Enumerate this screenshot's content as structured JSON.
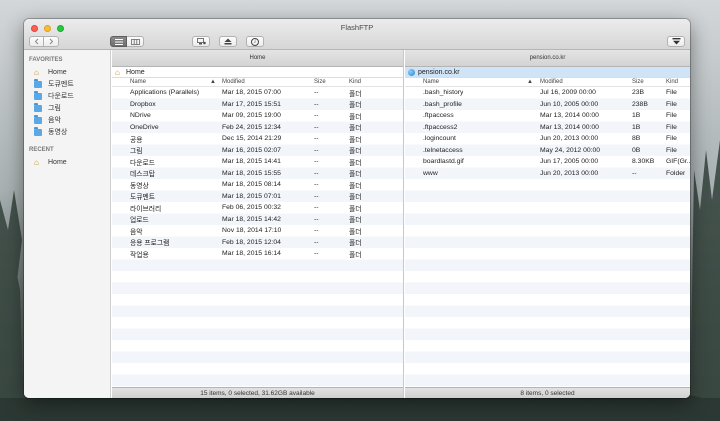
{
  "window": {
    "title": "FlashFTP"
  },
  "toolbar": {
    "back_icon": "chevron-left-icon",
    "forward_icon": "chevron-right-icon",
    "view_list_icon": "list-view-icon",
    "view_columns_icon": "column-view-icon",
    "connect_icon": "connect-icon",
    "eject_icon": "eject-icon",
    "info_icon": "info-icon",
    "menu_icon": "dropdown-icon",
    "info_glyph": "i"
  },
  "sidebar": {
    "favorites_header": "FAVORITES",
    "favorites": [
      {
        "label": "Home",
        "icon": "home-icon"
      },
      {
        "label": "도큐멘트",
        "icon": "folder-icon"
      },
      {
        "label": "다운로드",
        "icon": "folder-icon"
      },
      {
        "label": "그림",
        "icon": "folder-icon"
      },
      {
        "label": "음악",
        "icon": "folder-icon"
      },
      {
        "label": "동영상",
        "icon": "folder-icon"
      }
    ],
    "recent_header": "RECENT",
    "recent": [
      {
        "label": "Home",
        "icon": "home-icon"
      }
    ]
  },
  "left_pane": {
    "tab": "Home",
    "path": "Home",
    "columns": {
      "name": "Name",
      "modified": "Modified",
      "size": "Size",
      "kind": "Kind",
      "sort_indicator": "▲"
    },
    "rows": [
      {
        "name": "Applications (Parallels)",
        "modified": "Mar 18, 2015 07:00",
        "size": "--",
        "kind": "폴더",
        "icon": "app"
      },
      {
        "name": "Dropbox",
        "modified": "Mar 17, 2015 15:51",
        "size": "--",
        "kind": "폴더",
        "icon": "folder"
      },
      {
        "name": "NDrive",
        "modified": "Mar 09, 2015 19:00",
        "size": "--",
        "kind": "폴더",
        "icon": "ndrive"
      },
      {
        "name": "OneDrive",
        "modified": "Feb 24, 2015 12:34",
        "size": "--",
        "kind": "폴더",
        "icon": "onedrive"
      },
      {
        "name": "공용",
        "modified": "Dec 15, 2014 21:29",
        "size": "--",
        "kind": "폴더",
        "icon": "folder"
      },
      {
        "name": "그림",
        "modified": "Mar 16, 2015 02:07",
        "size": "--",
        "kind": "폴더",
        "icon": "folder"
      },
      {
        "name": "다운로드",
        "modified": "Mar 18, 2015 14:41",
        "size": "--",
        "kind": "폴더",
        "icon": "folder"
      },
      {
        "name": "데스크탑",
        "modified": "Mar 18, 2015 15:55",
        "size": "--",
        "kind": "폴더",
        "icon": "folder"
      },
      {
        "name": "동영상",
        "modified": "Mar 18, 2015 08:14",
        "size": "--",
        "kind": "폴더",
        "icon": "folder"
      },
      {
        "name": "도큐멘트",
        "modified": "Mar 18, 2015 07:01",
        "size": "--",
        "kind": "폴더",
        "icon": "folder"
      },
      {
        "name": "라이브러리",
        "modified": "Feb 06, 2015 00:32",
        "size": "--",
        "kind": "폴더",
        "icon": "folder"
      },
      {
        "name": "업로드",
        "modified": "Mar 18, 2015 14:42",
        "size": "--",
        "kind": "폴더",
        "icon": "folder"
      },
      {
        "name": "음악",
        "modified": "Nov 18, 2014 17:10",
        "size": "--",
        "kind": "폴더",
        "icon": "folder"
      },
      {
        "name": "응용 프로그램",
        "modified": "Feb 18, 2015 12:04",
        "size": "--",
        "kind": "폴더",
        "icon": "folder"
      },
      {
        "name": "작업용",
        "modified": "Mar 18, 2015 16:14",
        "size": "--",
        "kind": "폴더",
        "icon": "folder"
      }
    ],
    "status": "15 items, 0 selected, 31.62GB available"
  },
  "right_pane": {
    "tab": "pension.co.kr",
    "path": "pension.co.kr",
    "columns": {
      "name": "Name",
      "modified": "Modified",
      "size": "Size",
      "kind": "Kind",
      "sort_indicator": "▲"
    },
    "rows": [
      {
        "name": ".bash_history",
        "modified": "Jul 16, 2009 00:00",
        "size": "23B",
        "kind": "File",
        "icon": "file"
      },
      {
        "name": ".bash_profile",
        "modified": "Jun 10, 2005 00:00",
        "size": "238B",
        "kind": "File",
        "icon": "file"
      },
      {
        "name": ".ftpaccess",
        "modified": "Mar 13, 2014 00:00",
        "size": "1B",
        "kind": "File",
        "icon": "file"
      },
      {
        "name": ".ftpaccess2",
        "modified": "Mar 13, 2014 00:00",
        "size": "1B",
        "kind": "File",
        "icon": "file"
      },
      {
        "name": ".logincount",
        "modified": "Jun 20, 2013 00:00",
        "size": "8B",
        "kind": "File",
        "icon": "file"
      },
      {
        "name": ".telnetaccess",
        "modified": "May 24, 2012 00:00",
        "size": "0B",
        "kind": "File",
        "icon": "file"
      },
      {
        "name": "boardlastd.gif",
        "modified": "Jun 17, 2005 00:00",
        "size": "8.30KB",
        "kind": "GIF(Gr...",
        "icon": "image"
      },
      {
        "name": "www",
        "modified": "Jun 20, 2013 00:00",
        "size": "--",
        "kind": "Folder",
        "icon": "folder"
      }
    ],
    "status": "8 items, 0 selected"
  }
}
